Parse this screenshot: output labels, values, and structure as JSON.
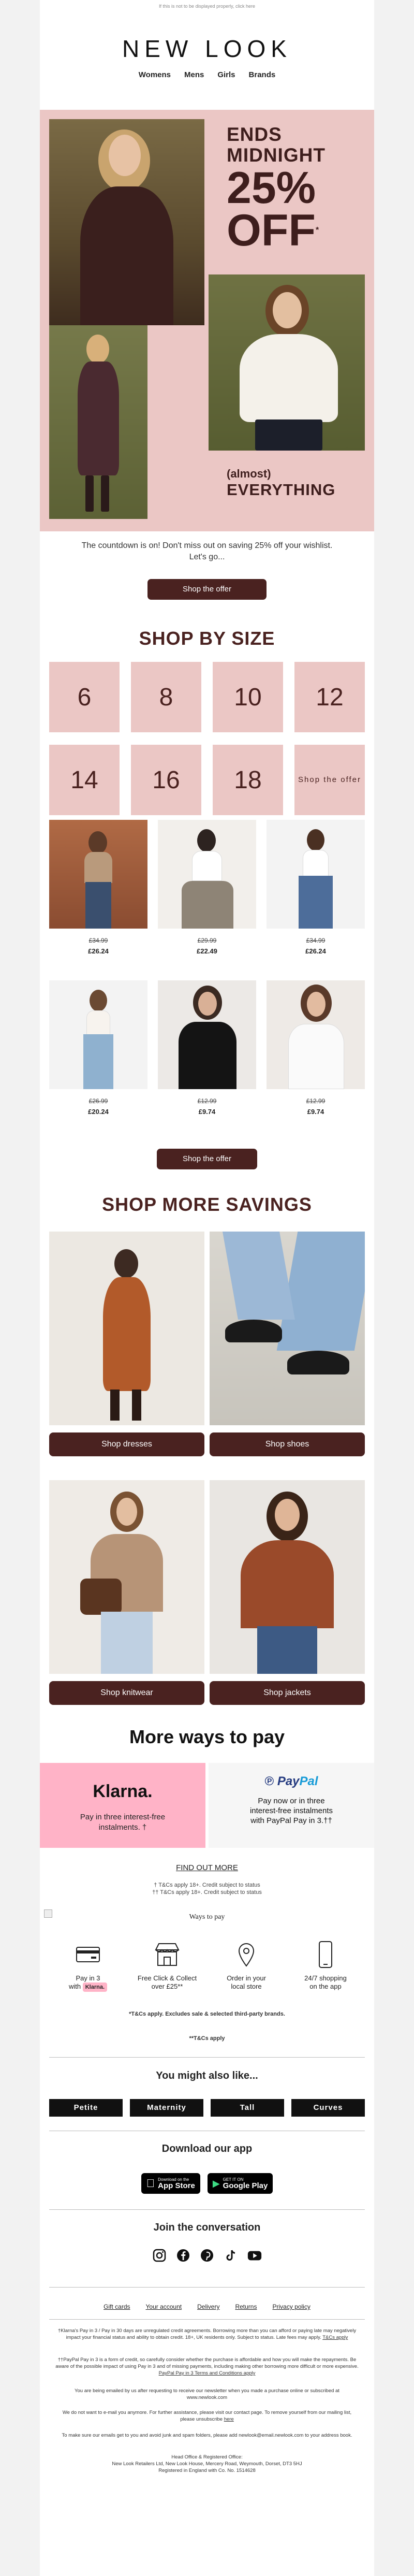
{
  "preheader": "If this is not to be displayed properly, click here",
  "brand": {
    "logo": "NEW LOOK"
  },
  "nav": [
    "Womens",
    "Mens",
    "Girls",
    "Brands"
  ],
  "hero": {
    "line1": "ENDS",
    "line2": "MIDNIGHT",
    "line3": "25%",
    "line4": "OFF",
    "asterisk": "*",
    "small": "(almost)",
    "big": "EVERYTHING"
  },
  "intro": {
    "line1": "The countdown is on! Don't miss out on saving 25% off your wishlist.",
    "line2": "Let's go..."
  },
  "cta_offer": "Shop the offer",
  "shop_by_size": {
    "title": "SHOP BY SIZE",
    "sizes": [
      "6",
      "8",
      "10",
      "12",
      "14",
      "16",
      "18"
    ],
    "offer_tile": "Shop the offer"
  },
  "products": [
    {
      "was": "£34.99",
      "now": "£26.24"
    },
    {
      "was": "£29.99",
      "now": "£22.49"
    },
    {
      "was": "£34.99",
      "now": "£26.24"
    },
    {
      "was": "£26.99",
      "now": "£20.24"
    },
    {
      "was": "£12.99",
      "now": "£9.74"
    },
    {
      "was": "£12.99",
      "now": "£9.74"
    }
  ],
  "more_savings": {
    "title": "SHOP MORE SAVINGS",
    "categories": [
      "Shop dresses",
      "Shop shoes",
      "Shop knitwear",
      "Shop jackets"
    ]
  },
  "payments": {
    "title": "More ways to pay",
    "klarna_logo": "Klarna.",
    "klarna_text_1": "Pay in three interest-free",
    "klarna_text_2": "instalments. †",
    "paypal_logo_a": "Pay",
    "paypal_logo_b": "Pal",
    "paypal_text_1": "Pay now or in three",
    "paypal_text_2": "interest-free instalments",
    "paypal_text_3": "with PayPal Pay in 3.††",
    "find_out_more": "FIND OUT MORE",
    "tc1": "† T&Cs apply 18+. Credit subject to status",
    "tc2": "†† T&Cs apply 18+. Credit subject to status",
    "ways_to_pay": "Ways to pay"
  },
  "features": [
    {
      "icon": "card-icon",
      "line1": "Pay in 3",
      "line2": "with",
      "badge": "Klarna."
    },
    {
      "icon": "store-icon",
      "line1": "Free Click & Collect",
      "line2": "over £25**"
    },
    {
      "icon": "location-pin-icon",
      "line1": "Order in your",
      "line2": "local store"
    },
    {
      "icon": "phone-icon",
      "line1": "24/7 shopping",
      "line2": "on the app"
    }
  ],
  "features_note": "*T&Cs apply. Excludes sale & selected third-party brands.",
  "features_note2": "**T&Cs apply",
  "also_like": {
    "title": "You might also like...",
    "items": [
      "Petite",
      "Maternity",
      "Tall",
      "Curves"
    ]
  },
  "app": {
    "title": "Download our app",
    "apple_small": "Download on the",
    "apple_big": "App Store",
    "google_small": "GET IT ON",
    "google_big": "Google Play"
  },
  "join": {
    "title": "Join the conversation"
  },
  "footer_links": [
    "Gift cards",
    "Your account",
    "Delivery",
    "Returns",
    "Privacy policy"
  ],
  "legal": {
    "p1": "†Klarna's Pay in 3 / Pay in 30 days are unregulated credit agreements. Borrowing more than you can afford or paying late may negatively impact your financial status and ability to obtain credit. 18+, UK residents only. Subject to status. Late fees may apply.",
    "p1_link": "T&Cs apply",
    "p2": "††PayPal Pay in 3 is a form of credit, so carefully consider whether the purchase is affordable and how you will make the repayments. Be aware of the possible impact of using Pay in 3 and of missing payments, including making other borrowing more difficult or more expensive.",
    "p2_link": "PayPal Pay in 3 Terms and Conditions apply",
    "p3": "You are being emailed by us after requesting to receive our newsletter when you made a purchase online or subscribed at www.newlook.com",
    "p4": "We do not want to e-mail you anymore. For further assistance, please visit our contact page. To remove yourself from our mailing list, please unsubscribe",
    "p4_link": "here",
    "p5": "To make sure our emails get to you and avoid junk and spam folders, please add newlook@email.newlook.com to your address book.",
    "p6_1": "Head Office & Registered Office:",
    "p6_2": "New Look Retailers Ltd, New Look House, Mercery Road, Weymouth, Dorset, DT3 5HJ",
    "p6_3": "Registered in England with Co. No. 1514628"
  },
  "colors": {
    "brand_brown": "#4a2220",
    "pink": "#ebc7c5",
    "klarna_pink": "#ffb3c7"
  }
}
